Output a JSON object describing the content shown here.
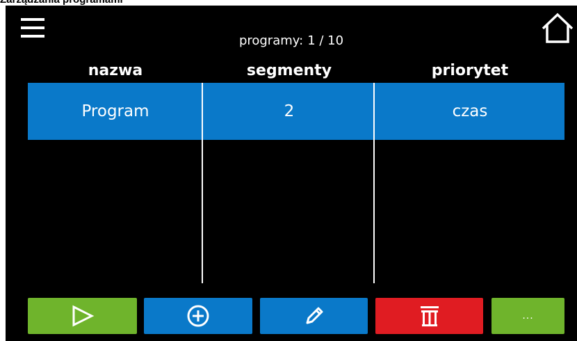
{
  "page": {
    "heading": "Zarządzania programami"
  },
  "header": {
    "counter_label": "programy:",
    "counter_value": "1 / 10",
    "menu_icon": "hamburger-menu-icon",
    "home_icon": "home-icon"
  },
  "table": {
    "columns": [
      "nazwa",
      "segmenty",
      "priorytet"
    ],
    "rows": [
      {
        "nazwa": "Program",
        "segmenty": "2",
        "priorytet": "czas",
        "selected": true
      }
    ]
  },
  "toolbar": {
    "buttons": [
      {
        "icon": "play-icon",
        "color": "#6fb42c"
      },
      {
        "icon": "add-circle-icon",
        "color": "#0a79c9"
      },
      {
        "icon": "pencil-edit-icon",
        "color": "#0a79c9"
      },
      {
        "icon": "trash-delete-icon",
        "color": "#e01c22"
      },
      {
        "icon": "more-dots-icon",
        "color": "#6fb42c",
        "label": "..."
      }
    ]
  },
  "colors": {
    "background": "#000000",
    "accent_blue": "#0a79c9",
    "accent_green": "#6fb42c",
    "danger_red": "#e01c22"
  }
}
